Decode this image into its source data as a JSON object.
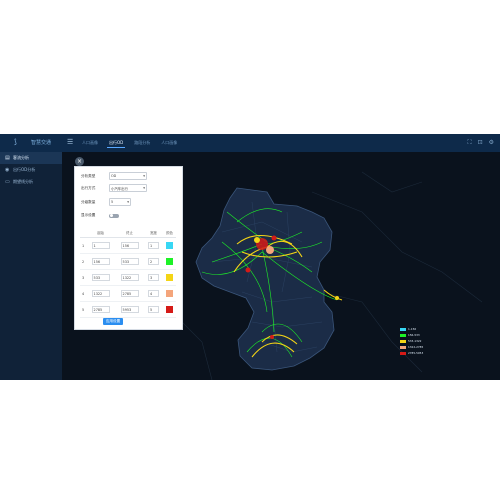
{
  "header": {
    "logo_text": "智慧交通",
    "menu_icon": "hamburger-icon",
    "tabs": [
      "人口画像",
      "出行OD",
      "路段分析",
      "人口画像"
    ],
    "active_tab_index": 1,
    "icons": [
      "fullscreen-icon",
      "expand-icon",
      "settings-icon"
    ]
  },
  "sidebar": {
    "items": [
      {
        "label": "客流分析",
        "icon": "chart-icon",
        "active": true
      },
      {
        "label": "出行OD分析",
        "icon": "location-icon",
        "active": false
      },
      {
        "label": "期望线分析",
        "icon": "document-icon",
        "active": false
      }
    ]
  },
  "panel": {
    "close_label": "×",
    "fields": [
      {
        "label": "分析类型",
        "value": "OD"
      },
      {
        "label": "出行方式",
        "value": "小汽车出行"
      },
      {
        "label": "分级数量",
        "value": "5"
      },
      {
        "label": "显示设置",
        "value": ""
      }
    ],
    "table": {
      "headers": [
        "",
        "起始",
        "终止",
        "宽度",
        "颜色"
      ],
      "rows": [
        {
          "idx": "1",
          "start": "1",
          "end": "156",
          "width": "1",
          "color": "#37d7f4"
        },
        {
          "idx": "2",
          "start": "156",
          "end": "533",
          "width": "2",
          "color": "#1df227"
        },
        {
          "idx": "3",
          "start": "533",
          "end": "1322",
          "width": "3",
          "color": "#f4d516"
        },
        {
          "idx": "4",
          "start": "1322",
          "end": "2785",
          "width": "4",
          "color": "#f4a57b"
        },
        {
          "idx": "5",
          "start": "2785",
          "end": "5953",
          "width": "5",
          "color": "#d51a17"
        }
      ]
    },
    "confirm_label": "应用设置"
  },
  "legend": [
    {
      "label": "1-156",
      "color": "#37d7f4"
    },
    {
      "label": "156-533",
      "color": "#1df227"
    },
    {
      "label": "533-1322",
      "color": "#f4d516"
    },
    {
      "label": "1322-2785",
      "color": "#f4a57b"
    },
    {
      "label": "2785-5953",
      "color": "#d51a17"
    }
  ]
}
